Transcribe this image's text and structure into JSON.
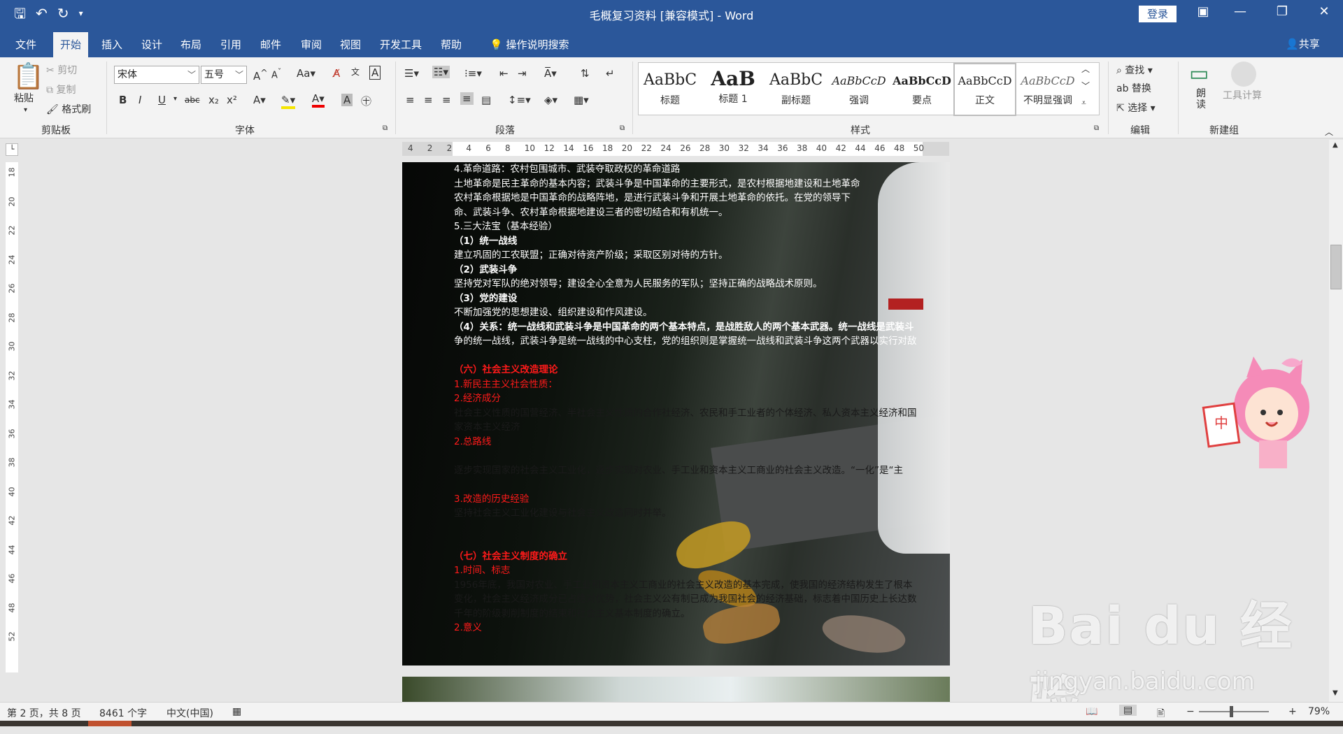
{
  "window": {
    "title": "毛概复习资料 [兼容模式] - Word",
    "login": "登录"
  },
  "tabs": [
    "文件",
    "开始",
    "插入",
    "设计",
    "布局",
    "引用",
    "邮件",
    "审阅",
    "视图",
    "开发工具",
    "帮助",
    "操作说明搜索"
  ],
  "share_label": "共享",
  "clipboard": {
    "paste": "粘贴",
    "cut": "剪切",
    "copy": "复制",
    "format_painter": "格式刷",
    "label": "剪贴板"
  },
  "font": {
    "name": "宋体",
    "size": "五号",
    "label": "字体",
    "aa": "Aa",
    "bold": "B",
    "italic": "I",
    "underline": "U",
    "strike": "abc",
    "sub": "x₂",
    "sup": "x²",
    "color_a": "A"
  },
  "paragraph": {
    "label": "段落"
  },
  "styles": {
    "label": "样式",
    "items": [
      {
        "preview": "AaBbC",
        "name": "标题"
      },
      {
        "preview": "AaB",
        "name": "标题 1"
      },
      {
        "preview": "AaBbC",
        "name": "副标题"
      },
      {
        "preview": "AaBbCcD",
        "name": "强调"
      },
      {
        "preview": "AaBbCcD",
        "name": "要点"
      },
      {
        "preview": "AaBbCcD",
        "name": "正文"
      },
      {
        "preview": "AaBbCcD",
        "name": "不明显强调"
      }
    ]
  },
  "editing": {
    "find": "查找",
    "replace": "替换",
    "select": "选择",
    "label": "编辑"
  },
  "newgroup": {
    "read": "朗读",
    "tool": "工具计算",
    "label": "新建组"
  },
  "ruler_h": [
    "4",
    "2",
    "2",
    "4",
    "6",
    "8",
    "10",
    "12",
    "14",
    "16",
    "18",
    "20",
    "22",
    "24",
    "26",
    "28",
    "30",
    "32",
    "34",
    "36",
    "38",
    "40",
    "42",
    "44",
    "46",
    "48",
    "50"
  ],
  "ruler_v": [
    "18",
    "20",
    "22",
    "24",
    "26",
    "28",
    "30",
    "32",
    "34",
    "36",
    "38",
    "40",
    "42",
    "44",
    "46",
    "48",
    "52"
  ],
  "document": {
    "lines": [
      {
        "text": "4.革命道路：农村包围城市、武装夺取政权的革命道路",
        "style": ""
      },
      {
        "text": "土地革命是民主革命的基本内容；武装斗争是中国革命的主要形式，是农村根据地建设和土地革命",
        "style": ""
      },
      {
        "text": "农村革命根据地是中国革命的战略阵地，是进行武装斗争和开展土地革命的依托。在党的领导下",
        "style": ""
      },
      {
        "text": "命、武装斗争、农村革命根据地建设三者的密切结合和有机统一。",
        "style": ""
      },
      {
        "text": "5.三大法宝（基本经验）",
        "style": ""
      },
      {
        "text": "（1）统一战线",
        "style": "b"
      },
      {
        "text": "建立巩固的工农联盟；正确对待资产阶级；采取区别对待的方针。",
        "style": ""
      },
      {
        "text": "（2）武装斗争",
        "style": "b"
      },
      {
        "text": "坚持党对军队的绝对领导；建设全心全意为人民服务的军队；坚持正确的战略战术原则。",
        "style": ""
      },
      {
        "text": "（3）党的建设",
        "style": "b"
      },
      {
        "text": "不断加强党的思想建设、组织建设和作风建设。",
        "style": ""
      },
      {
        "text": "（4）关系：统一战线和武装斗争是中国革命的两个基本特点，是战胜敌人的两个基本武器。统一战线是武装斗",
        "style": "bhead"
      },
      {
        "text": "争的统一战线，武装斗争是统一战线的中心支柱，党的组织则是掌握统一战线和武装斗争这两个武器以实行对敌",
        "style": ""
      },
      {
        "text": "",
        "style": ""
      },
      {
        "text": "（六）社会主义改造理论",
        "style": "rb"
      },
      {
        "text": "1.新民主主义社会性质：",
        "style": "red"
      },
      {
        "text": "2.经济成分",
        "style": "red"
      },
      {
        "text": "社会主义性质的国营经济、半社会主义性质的合作社经济、农民和手工业者的个体经济、私人资本主义经济和国",
        "style": "dark"
      },
      {
        "text": "家资本主义经济",
        "style": "dark"
      },
      {
        "text": "2.总路线",
        "style": "red"
      },
      {
        "text": "",
        "style": ""
      },
      {
        "text": "逐步实现国家的社会主义工业化，逐步实现对农业、手工业和资本主义工商业的社会主义改造。“一化”是“主",
        "style": "dark"
      },
      {
        "text": "",
        "style": ""
      },
      {
        "text": "3.改造的历史经验",
        "style": "red"
      },
      {
        "text": "坚持社会主义工业化建设与社会主义改造同时并举。",
        "style": "dark"
      },
      {
        "text": "",
        "style": ""
      },
      {
        "text": "",
        "style": ""
      },
      {
        "text": "（七）社会主义制度的确立",
        "style": "rb"
      },
      {
        "text": "1.时间、标志",
        "style": "red"
      },
      {
        "text": "1956年底，我国对农业、手工业和资本主义工商业的社会主义改造的基本完成，使我国的经济结构发生了根本",
        "style": "dark"
      },
      {
        "text": "变化，社会主义经济成分已占绝对优势，社会主义公有制已成为我国社会的经济基础，标志着中国历史上长达数",
        "style": "dark"
      },
      {
        "text": "千年的阶级剥削制度的结束和社会主义基本制度的确立。",
        "style": "dark"
      },
      {
        "text": "2.意义",
        "style": "red"
      }
    ]
  },
  "status": {
    "page": "第 2 页，共 8 页",
    "words": "8461 个字",
    "lang": "中文(中国)",
    "zoom": "79%"
  },
  "mascot_text": "中",
  "watermark": {
    "main": "Bai du 经验",
    "sub": "jingyan.baidu.com"
  }
}
